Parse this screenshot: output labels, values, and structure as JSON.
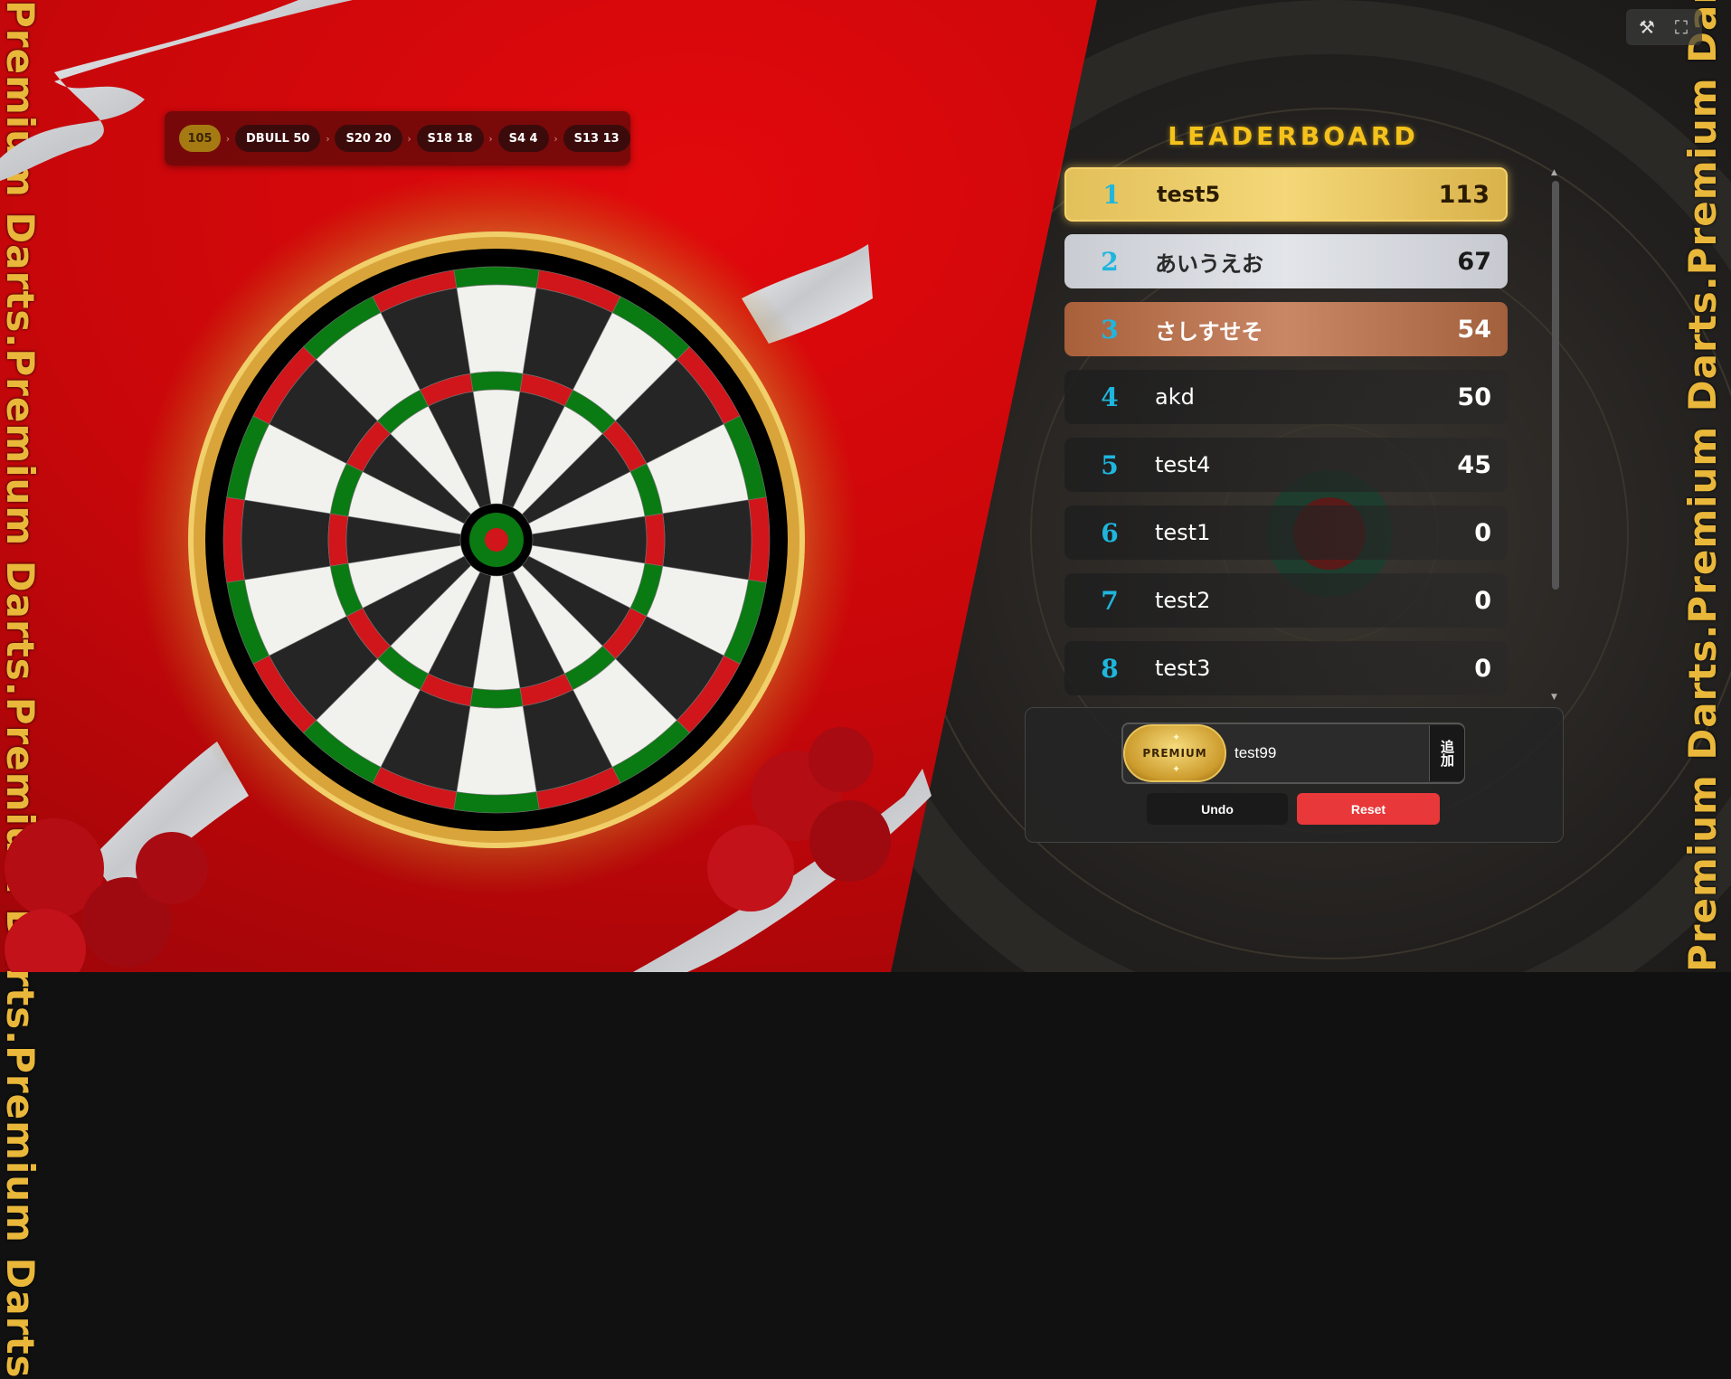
{
  "branding": {
    "side_text_left": "Premium Darts.Premium Darts.Premium Darts.Premium Darts",
    "side_text_right": "Premium Darts.Premium Darts.Premium Darts.Premium Darts"
  },
  "history": {
    "total": "105",
    "throws": [
      "DBULL 50",
      "S20 20",
      "S18 18",
      "S4 4",
      "S13 13"
    ],
    "separator": "›"
  },
  "leaderboard": {
    "title": "LEADERBOARD",
    "players": [
      {
        "rank": "1",
        "name": "test5",
        "score": "113"
      },
      {
        "rank": "2",
        "name": "あいうえお",
        "score": "67"
      },
      {
        "rank": "3",
        "name": "さしすせそ",
        "score": "54"
      },
      {
        "rank": "4",
        "name": "akd",
        "score": "50"
      },
      {
        "rank": "5",
        "name": "test4",
        "score": "45"
      },
      {
        "rank": "6",
        "name": "test1",
        "score": "0"
      },
      {
        "rank": "7",
        "name": "test2",
        "score": "0"
      },
      {
        "rank": "8",
        "name": "test3",
        "score": "0"
      }
    ]
  },
  "entry": {
    "badge_label": "PREMIUM",
    "name_value": "test99",
    "add_label": "追加",
    "undo_label": "Undo",
    "reset_label": "Reset"
  },
  "toolbar": {
    "tools_icon": "tools-icon",
    "fullscreen_icon": "fullscreen-icon"
  },
  "colors": {
    "gold": "#f5c21b",
    "rank_blue": "#1fb6de",
    "reset_red": "#e8383a",
    "board_red": "#d0161a",
    "board_green": "#0a7a12"
  }
}
